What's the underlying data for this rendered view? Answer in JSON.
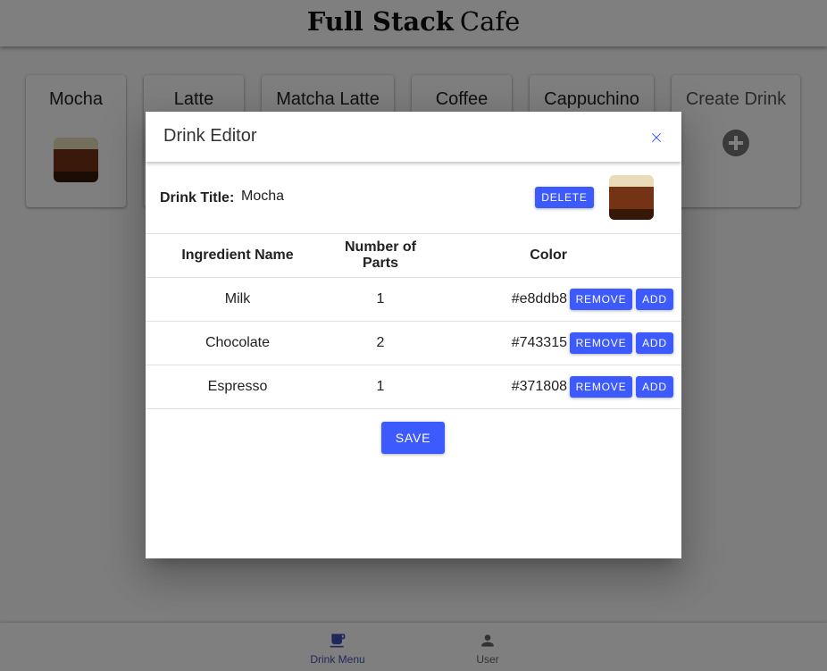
{
  "app": {
    "title_bold": "Full Stack",
    "title_light": "Cafe"
  },
  "drinks": [
    {
      "name": "Mocha",
      "layers": [
        {
          "color": "#e8ddb8",
          "parts": 1
        },
        {
          "color": "#743315",
          "parts": 2
        },
        {
          "color": "#371808",
          "parts": 1
        }
      ]
    },
    {
      "name": "Latte"
    },
    {
      "name": "Matcha Latte"
    },
    {
      "name": "Coffee"
    },
    {
      "name": "Cappuchino"
    }
  ],
  "create_drink": {
    "label": "Create Drink",
    "icon": "add-circle-icon"
  },
  "dialog": {
    "title": "Drink Editor",
    "close_icon": "close-icon",
    "drink_title_label": "Drink Title:",
    "drink_title_value": "Mocha",
    "delete_label": "DELETE",
    "columns": [
      "Ingredient Name",
      "Number of Parts",
      "Color"
    ],
    "ingredients": [
      {
        "name": "Milk",
        "parts": "1",
        "color": "#e8ddb8"
      },
      {
        "name": "Chocolate",
        "parts": "2",
        "color": "#743315"
      },
      {
        "name": "Espresso",
        "parts": "1",
        "color": "#371808"
      }
    ],
    "remove_label": "REMOVE",
    "add_label": "ADD",
    "save_label": "SAVE"
  },
  "nav": [
    {
      "label": "Drink Menu",
      "icon": "coffee-cup-icon",
      "active": true
    },
    {
      "label": "User",
      "icon": "person-icon",
      "active": false
    }
  ],
  "colors": {
    "accent": "#3d5afe",
    "nav_active": "#3f51b5"
  }
}
